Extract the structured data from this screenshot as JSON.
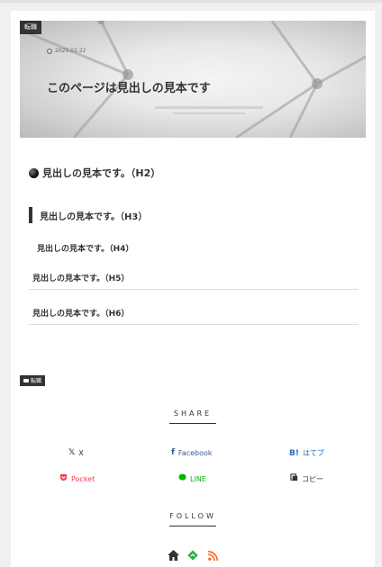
{
  "article": {
    "category": "転職",
    "date": "2025.03.22",
    "title": "このページは見出しの見本です"
  },
  "headings": {
    "h2": "見出しの見本です。（H2）",
    "h3": "見出しの見本です。（H3）",
    "h4": "見出しの見本です。（H4）",
    "h5": "見出しの見本です。（H5）",
    "h6": "見出しの見本です。（H6）"
  },
  "footer": {
    "category_tag": "転職",
    "share_title": "SHARE",
    "follow_title": "FOLLOW",
    "share_buttons": [
      {
        "label": "X",
        "icon": "x-icon",
        "color": "#333333"
      },
      {
        "label": "Facebook",
        "icon": "facebook-icon",
        "color": "#3b5998"
      },
      {
        "label": "はてブ",
        "icon": "hatena-icon",
        "color": "#2c6ebd"
      },
      {
        "label": "Pocket",
        "icon": "pocket-icon",
        "color": "#ef4056"
      },
      {
        "label": "LINE",
        "icon": "line-icon",
        "color": "#00b900"
      },
      {
        "label": "コピー",
        "icon": "copy-icon",
        "color": "#333333"
      }
    ],
    "follow_icons": [
      "home-icon",
      "feedly-icon",
      "rss-icon"
    ]
  }
}
